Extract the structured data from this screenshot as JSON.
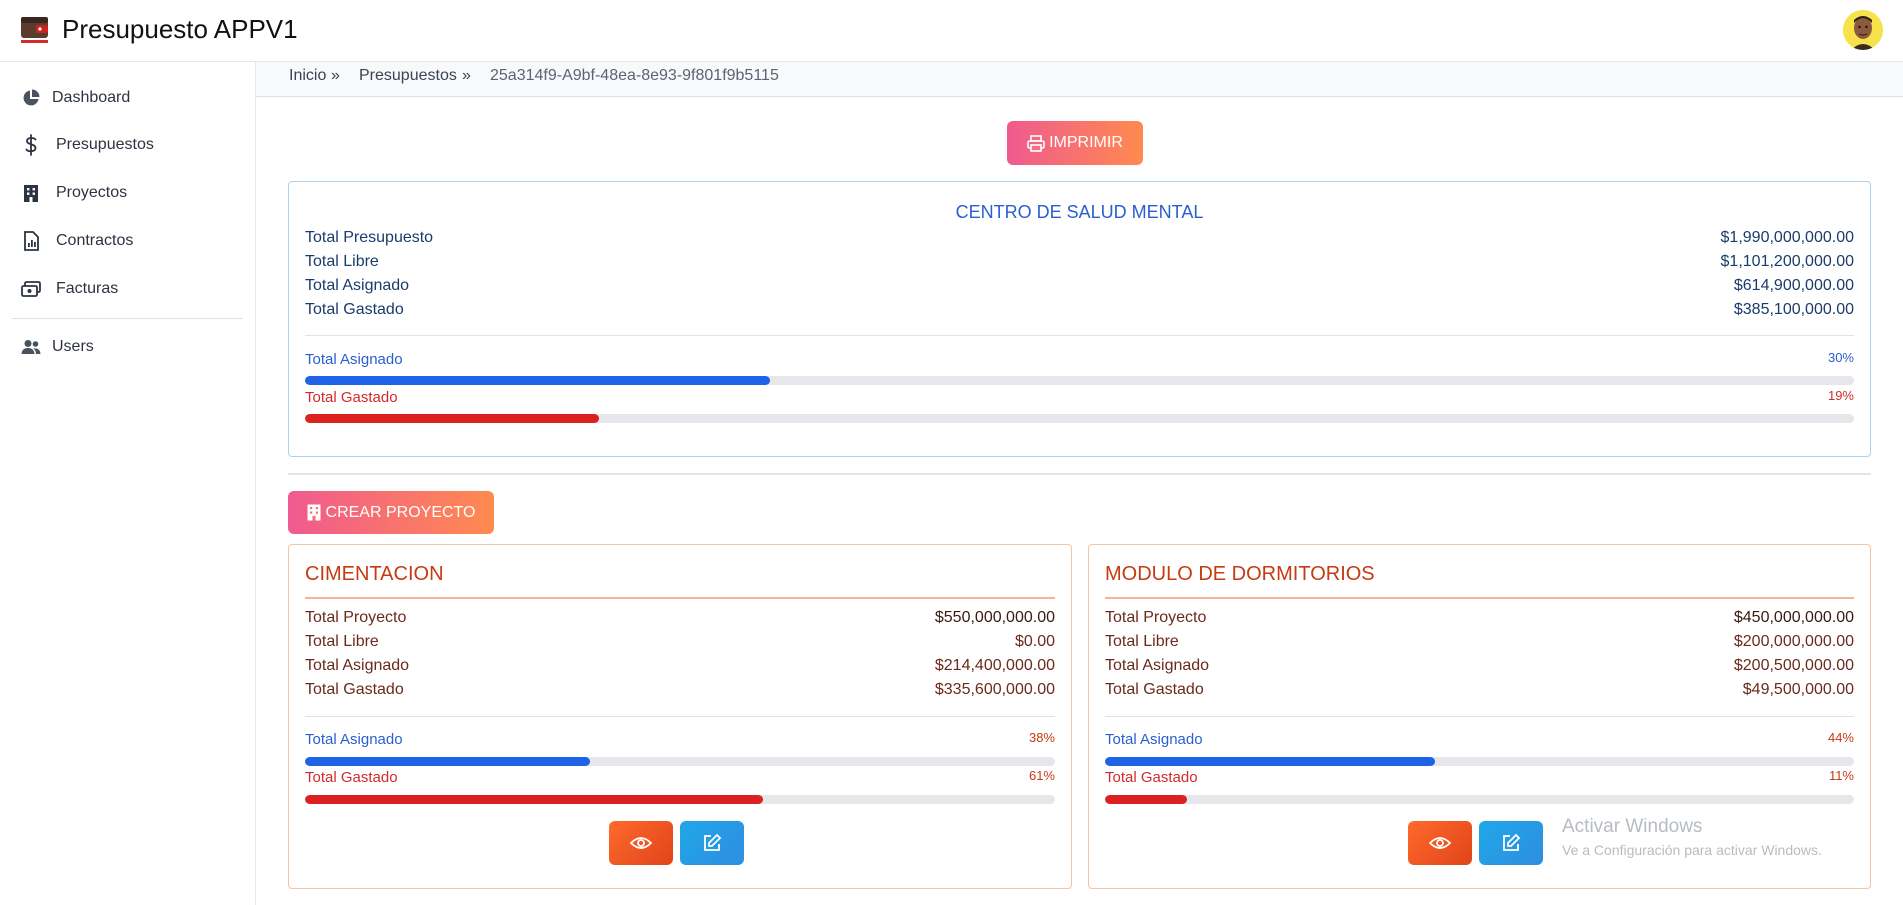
{
  "app": {
    "title": "Presupuesto APPV1"
  },
  "sidebar": {
    "items": [
      {
        "label": "Dashboard",
        "icon": "pie-chart-icon"
      },
      {
        "label": "Presupuestos",
        "icon": "dollar-icon"
      },
      {
        "label": "Proyectos",
        "icon": "building-icon"
      },
      {
        "label": "Contractos",
        "icon": "document-chart-icon"
      },
      {
        "label": "Facturas",
        "icon": "cash-icon"
      },
      {
        "label": "Users",
        "icon": "users-icon"
      }
    ]
  },
  "breadcrumb": {
    "items": [
      "Inicio",
      "Presupuestos",
      "25a314f9-A9bf-48ea-8e93-9f801f9b5115"
    ],
    "separator": "»"
  },
  "print_button": {
    "label": "IMPRIMIR"
  },
  "budget": {
    "title": "CENTRO DE SALUD MENTAL",
    "rows": [
      {
        "label": "Total Presupuesto",
        "value": "$1,990,000,000.00"
      },
      {
        "label": "Total Libre",
        "value": "$1,101,200,000.00"
      },
      {
        "label": "Total Asignado",
        "value": "$614,900,000.00"
      },
      {
        "label": "Total Gastado",
        "value": "$385,100,000.00"
      }
    ],
    "assigned": {
      "label": "Total Asignado",
      "percent_label": "30%",
      "percent": 30
    },
    "spent": {
      "label": "Total Gastado",
      "percent_label": "19%",
      "percent": 19
    }
  },
  "create_button": {
    "label": "CREAR PROYECTO"
  },
  "projects": [
    {
      "title": "CIMENTACION",
      "rows": [
        {
          "label": "Total Proyecto",
          "value": "$550,000,000.00"
        },
        {
          "label": "Total Libre",
          "value": "$0.00"
        },
        {
          "label": "Total Asignado",
          "value": "$214,400,000.00"
        },
        {
          "label": "Total Gastado",
          "value": "$335,600,000.00"
        }
      ],
      "assigned": {
        "label": "Total Asignado",
        "percent_label": "38%",
        "percent": 38
      },
      "spent": {
        "label": "Total Gastado",
        "percent_label": "61%",
        "percent": 61
      }
    },
    {
      "title": "MODULO DE DORMITORIOS",
      "rows": [
        {
          "label": "Total Proyecto",
          "value": "$450,000,000.00"
        },
        {
          "label": "Total Libre",
          "value": "$200,000,000.00"
        },
        {
          "label": "Total Asignado",
          "value": "$200,500,000.00"
        },
        {
          "label": "Total Gastado",
          "value": "$49,500,000.00"
        }
      ],
      "assigned": {
        "label": "Total Asignado",
        "percent_label": "44%",
        "percent": 44
      },
      "spent": {
        "label": "Total Gastado",
        "percent_label": "11%",
        "percent": 11
      }
    }
  ],
  "watermark": {
    "line1": "Activar Windows",
    "line2": "Ve a Configuración para activar Windows."
  },
  "colors": {
    "accent_blue": "#1e62e8",
    "accent_red": "#dc2121",
    "button_gradient_start": "#f05a8f",
    "button_gradient_end": "#ff8a4f",
    "view_button": "#ff6a2c",
    "edit_button": "#1fa8e8"
  }
}
